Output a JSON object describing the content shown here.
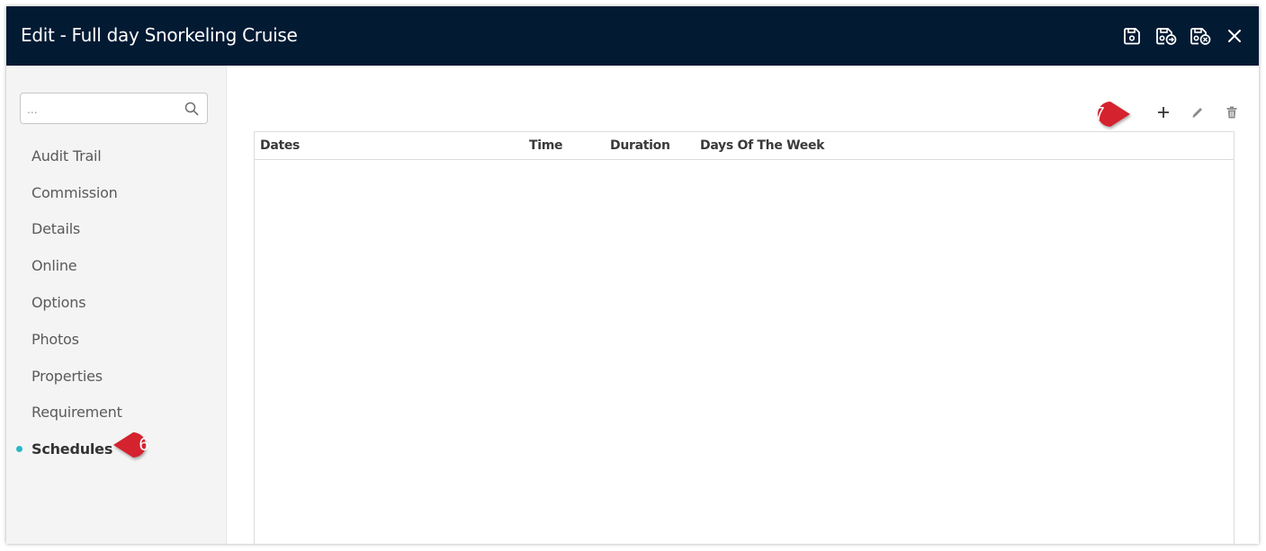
{
  "window": {
    "title": "Edit - Full day Snorkeling Cruise",
    "header_color": "#031a33"
  },
  "header_actions": [
    {
      "icon": "save-icon"
    },
    {
      "icon": "save-and-continue-icon"
    },
    {
      "icon": "save-and-close-icon"
    },
    {
      "icon": "close-icon"
    }
  ],
  "sidebar": {
    "search": {
      "placeholder": "...",
      "value": ""
    },
    "items": [
      {
        "label": "Audit Trail",
        "active": false
      },
      {
        "label": "Commission",
        "active": false
      },
      {
        "label": "Details",
        "active": false
      },
      {
        "label": "Online",
        "active": false
      },
      {
        "label": "Options",
        "active": false
      },
      {
        "label": "Photos",
        "active": false
      },
      {
        "label": "Properties",
        "active": false
      },
      {
        "label": "Requirement",
        "active": false
      },
      {
        "label": "Schedules",
        "active": true
      }
    ],
    "active_indicator_color": "#2ab7c9"
  },
  "toolbar": [
    {
      "icon": "add-icon"
    },
    {
      "icon": "edit-icon"
    },
    {
      "icon": "delete-icon"
    }
  ],
  "table": {
    "columns": [
      "Dates",
      "Time",
      "Duration",
      "Days Of The Week"
    ],
    "rows": []
  },
  "callouts": [
    {
      "number": "6",
      "color": "#d4202f"
    },
    {
      "number": "7",
      "color": "#d4202f"
    }
  ]
}
